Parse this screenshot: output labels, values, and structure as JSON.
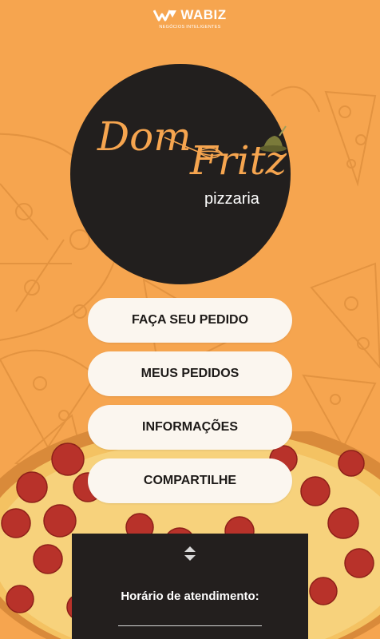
{
  "brand": {
    "name": "WABIZ",
    "tagline": "NEGÓCIOS INTELIGENTES"
  },
  "logo": {
    "line1": "Dom",
    "line2": "Fritz",
    "subtitle": "pizzaria"
  },
  "menu": [
    {
      "label": "FAÇA SEU PEDIDO"
    },
    {
      "label": "MEUS PEDIDOS"
    },
    {
      "label": "INFORMAÇÕES"
    },
    {
      "label": "COMPARTILHE"
    }
  ],
  "footer": {
    "hours_title": "Horário de atendimento:"
  },
  "colors": {
    "background": "#F6A54F",
    "logo_circle": "#221F1E",
    "logo_text": "#F6A54F",
    "button_bg": "#FBF6EF",
    "button_text": "#1D1A18",
    "panel": "#231F1E"
  },
  "icons": {
    "brand": "wabiz-logo-icon",
    "toggle": "expand-collapse-icon",
    "hat": "tyrolean-hat-icon",
    "whisk": "whisk-icon"
  }
}
